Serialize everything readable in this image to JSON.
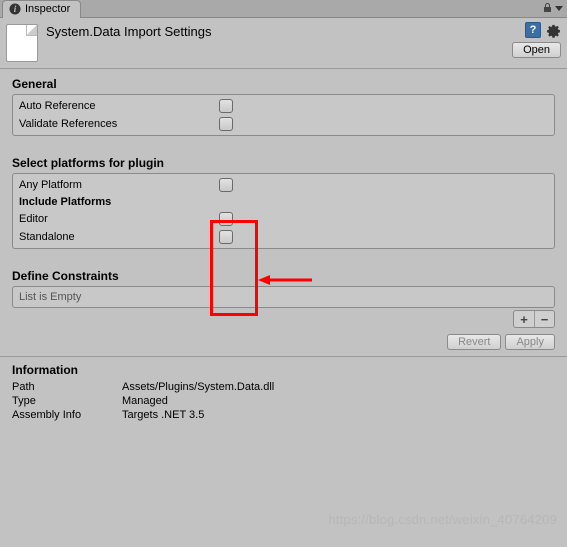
{
  "tab": {
    "label": "Inspector"
  },
  "header": {
    "title": "System.Data Import Settings",
    "open_label": "Open"
  },
  "general": {
    "title": "General",
    "auto_reference_label": "Auto Reference",
    "validate_references_label": "Validate References"
  },
  "platforms": {
    "title": "Select platforms for plugin",
    "any_platform_label": "Any Platform",
    "include_title": "Include Platforms",
    "editor_label": "Editor",
    "standalone_label": "Standalone"
  },
  "constraints": {
    "title": "Define Constraints",
    "empty_text": "List is Empty",
    "add_label": "+",
    "remove_label": "−"
  },
  "buttons": {
    "revert": "Revert",
    "apply": "Apply"
  },
  "information": {
    "title": "Information",
    "path_label": "Path",
    "path_value": "Assets/Plugins/System.Data.dll",
    "type_label": "Type",
    "type_value": "Managed",
    "assembly_label": "Assembly Info",
    "assembly_value": "Targets .NET 3.5"
  },
  "watermark": "https://blog.csdn.net/weixin_40764209"
}
